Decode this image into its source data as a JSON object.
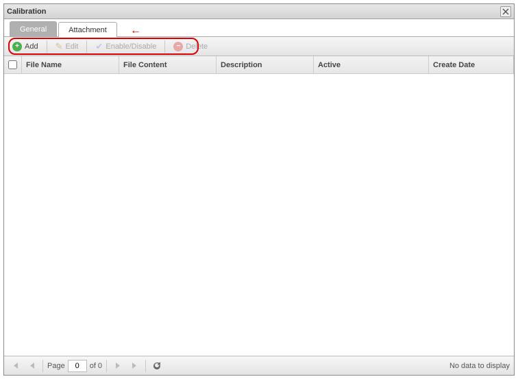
{
  "window": {
    "title": "Calibration"
  },
  "tabs": [
    {
      "label": "General",
      "active": false
    },
    {
      "label": "Attachment",
      "active": true
    }
  ],
  "toolbar": {
    "add": "Add",
    "edit": "Edit",
    "enable_disable": "Enable/Disable",
    "delete": "Delete"
  },
  "columns": {
    "file_name": "File Name",
    "file_content": "File Content",
    "description": "Description",
    "active": "Active",
    "create_date": "Create Date"
  },
  "rows": [],
  "pager": {
    "page_label": "Page",
    "current": "0",
    "of_label": "of 0",
    "status": "No data to display"
  }
}
